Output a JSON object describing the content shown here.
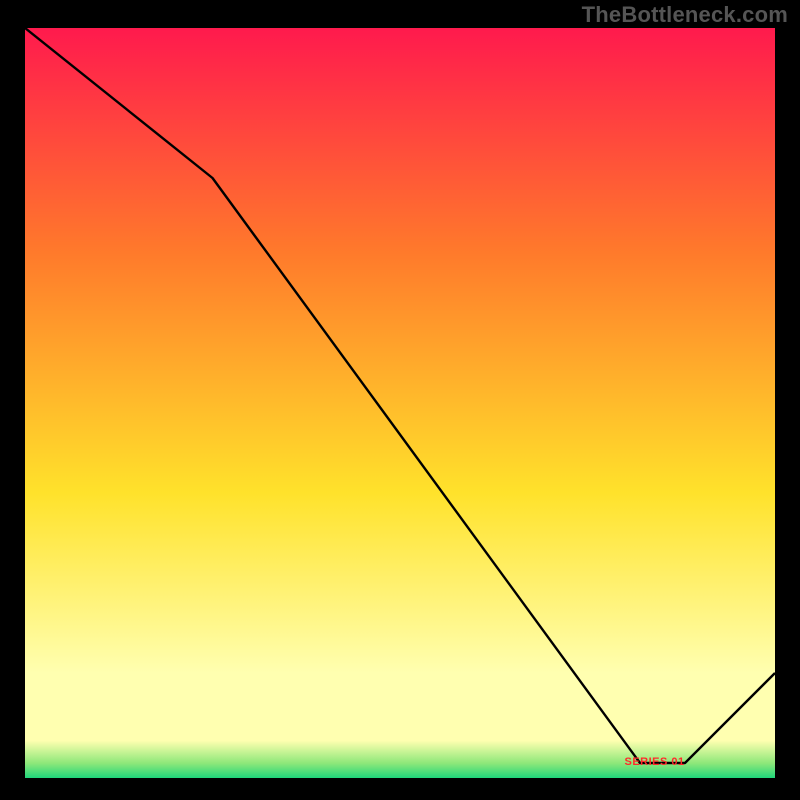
{
  "attribution": "TheBottleneck.com",
  "colors": {
    "background": "#000000",
    "line": "#000000",
    "attribution_text": "#555555",
    "label_text": "#ff2a2a",
    "gradient_top": "#ff1a4d",
    "gradient_upper_mid": "#ff7a2b",
    "gradient_mid": "#ffe22b",
    "gradient_lower_band": "#ffffb0",
    "gradient_bottom": "#1fd67a"
  },
  "series_label": "SERIES 01",
  "chart_data": {
    "type": "line",
    "title": "",
    "xlabel": "",
    "ylabel": "",
    "xlim": [
      0,
      100
    ],
    "ylim": [
      0,
      100
    ],
    "comment": "Values estimated from pixel positions; no tick labels or gridlines visible.",
    "series": [
      {
        "name": "SERIES 01",
        "x": [
          0,
          25,
          82,
          88,
          100
        ],
        "y": [
          100,
          80,
          2,
          2,
          14
        ]
      }
    ]
  }
}
